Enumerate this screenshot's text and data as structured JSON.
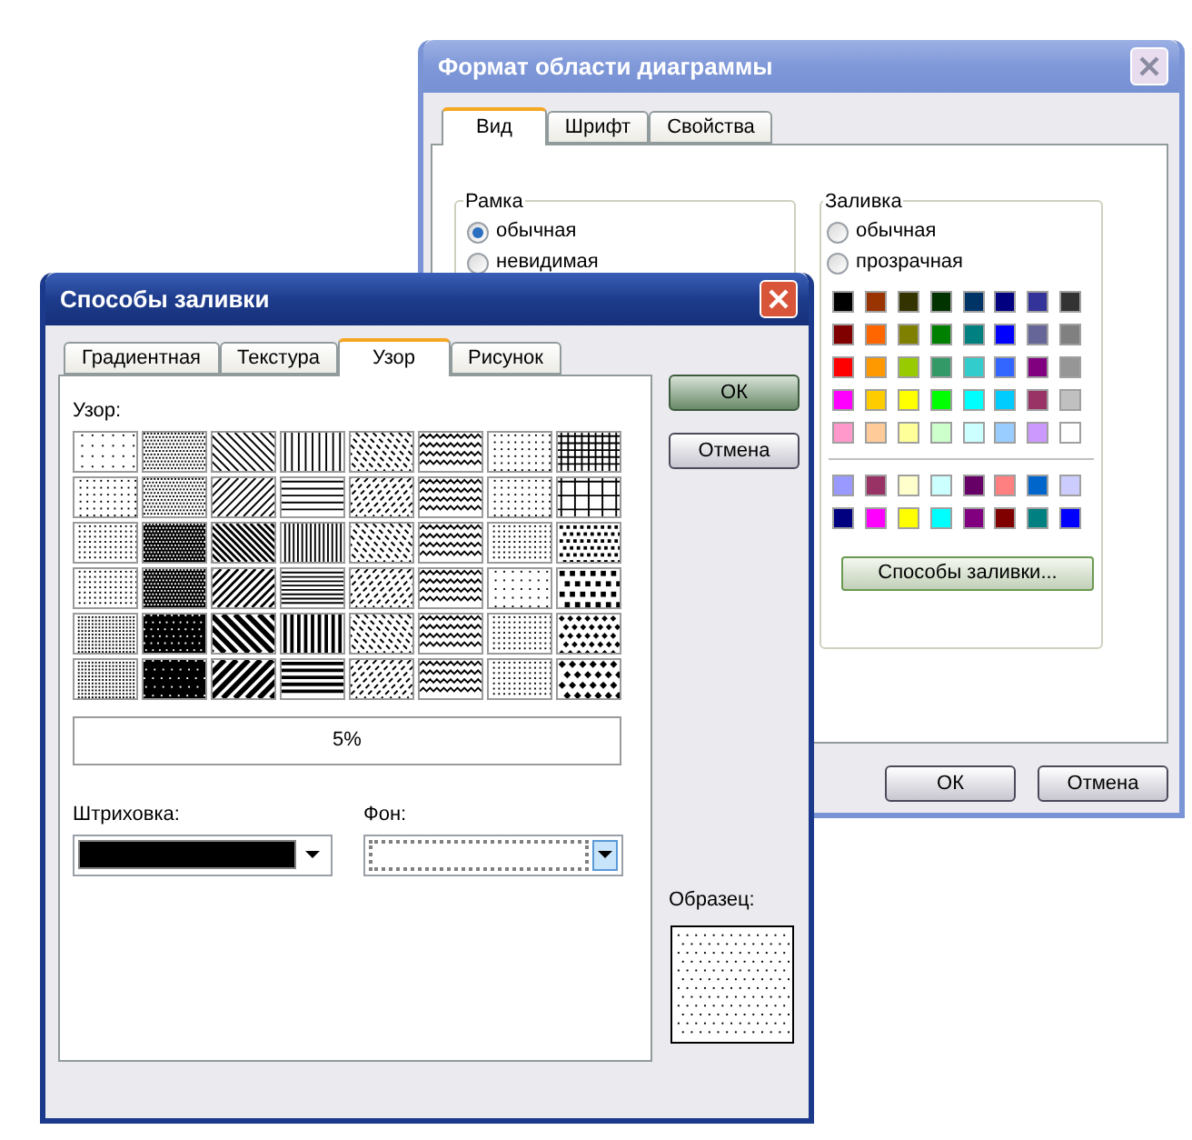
{
  "back_window": {
    "title": "Формат области диаграммы",
    "active": false,
    "tabs": [
      {
        "label": "Вид",
        "selected": true
      },
      {
        "label": "Шрифт",
        "selected": false
      },
      {
        "label": "Свойства",
        "selected": false
      }
    ],
    "frame_group": {
      "title": "Рамка",
      "options": [
        {
          "label": "обычная",
          "checked": true
        },
        {
          "label": "невидимая",
          "checked": false
        }
      ]
    },
    "fill_group": {
      "title": "Заливка",
      "options": [
        {
          "label": "обычная",
          "checked": false
        },
        {
          "label": "прозрачная",
          "checked": false
        }
      ],
      "palette": [
        {
          "color": "#000000"
        },
        {
          "color": "#993300"
        },
        {
          "color": "#333300"
        },
        {
          "color": "#003300"
        },
        {
          "color": "#003366"
        },
        {
          "color": "#000080"
        },
        {
          "color": "#333399"
        },
        {
          "color": "#333333"
        },
        {
          "color": "#800000"
        },
        {
          "color": "#ff6600"
        },
        {
          "color": "#808000"
        },
        {
          "color": "#008000"
        },
        {
          "color": "#008080"
        },
        {
          "color": "#0000ff"
        },
        {
          "color": "#666699"
        },
        {
          "color": "#808080"
        },
        {
          "color": "#ff0000"
        },
        {
          "color": "#ff9900"
        },
        {
          "color": "#99cc00"
        },
        {
          "color": "#339966"
        },
        {
          "color": "#33cccc"
        },
        {
          "color": "#3366ff"
        },
        {
          "color": "#800080"
        },
        {
          "color": "#969696"
        },
        {
          "color": "#ff00ff"
        },
        {
          "color": "#ffcc00"
        },
        {
          "color": "#ffff00"
        },
        {
          "color": "#00ff00"
        },
        {
          "color": "#00ffff"
        },
        {
          "color": "#00ccff"
        },
        {
          "color": "#993366"
        },
        {
          "color": "#c0c0c0"
        },
        {
          "color": "#ff99cc"
        },
        {
          "color": "#ffcc99"
        },
        {
          "color": "#ffff99"
        },
        {
          "color": "#ccffcc"
        },
        {
          "color": "#ccffff"
        },
        {
          "color": "#99ccff"
        },
        {
          "color": "#cc99ff"
        },
        {
          "color": "#ffffff"
        }
      ],
      "extra_colors": [
        {
          "color": "#9999ff"
        },
        {
          "color": "#993366"
        },
        {
          "color": "#ffffcc"
        },
        {
          "color": "#ccffff"
        },
        {
          "color": "#660066"
        },
        {
          "color": "#ff8080"
        },
        {
          "color": "#0066cc"
        },
        {
          "color": "#ccccff"
        },
        {
          "color": "#000080"
        },
        {
          "color": "#ff00ff"
        },
        {
          "color": "#ffff00"
        },
        {
          "color": "#00ffff"
        },
        {
          "color": "#800080"
        },
        {
          "color": "#800000"
        },
        {
          "color": "#008080"
        },
        {
          "color": "#0000ff"
        }
      ],
      "fill_effects_button": "Способы заливки..."
    },
    "buttons": [
      "ОК",
      "Отмена"
    ]
  },
  "front_window": {
    "title": "Способы заливки",
    "active": true,
    "tabs": [
      {
        "label": "Градиентная",
        "selected": false
      },
      {
        "label": "Текстура",
        "selected": false
      },
      {
        "label": "Узор",
        "selected": true
      },
      {
        "label": "Рисунок",
        "selected": false
      }
    ],
    "pattern_label": "Узор:",
    "selected_pattern": "5%",
    "foreground": {
      "label": "Штриховка:",
      "color": "#000000"
    },
    "background": {
      "label": "Фон:",
      "color": "#ffffff"
    },
    "buttons": [
      "ОК",
      "Отмена"
    ],
    "sample_label": "Образец:"
  }
}
